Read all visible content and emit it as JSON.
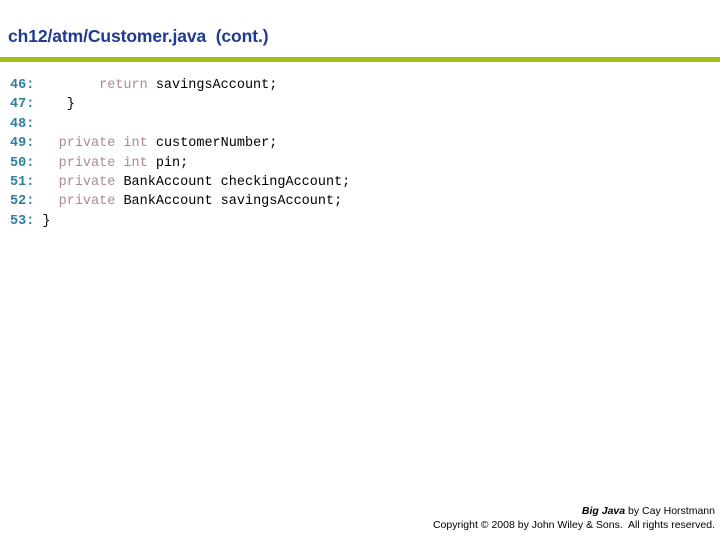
{
  "slide": {
    "title": "ch12/atm/Customer.java  (cont.)",
    "accent_green": "#a2c115",
    "title_color": "#1f3a93",
    "background": "#ffffff"
  },
  "code": {
    "language": "java",
    "line_number_color": "#2e7f9e",
    "keyword_color": "#ab8a96",
    "identifier_color": "#000000",
    "lines": [
      {
        "number": "46:",
        "segments": [
          {
            "text": "        ",
            "type": "plain"
          },
          {
            "text": "return",
            "type": "keyword"
          },
          {
            "text": " savingsAccount;",
            "type": "identifier"
          }
        ],
        "plain_text": "46:        return savingsAccount;"
      },
      {
        "number": "47:",
        "segments": [
          {
            "text": "    }",
            "type": "identifier"
          }
        ],
        "plain_text": "47:    }"
      },
      {
        "number": "48:",
        "segments": [],
        "plain_text": "48:"
      },
      {
        "number": "49:",
        "segments": [
          {
            "text": "   ",
            "type": "plain"
          },
          {
            "text": "private int",
            "type": "keyword"
          },
          {
            "text": " customerNumber;",
            "type": "identifier"
          }
        ],
        "plain_text": "49:   private int customerNumber;"
      },
      {
        "number": "50:",
        "segments": [
          {
            "text": "   ",
            "type": "plain"
          },
          {
            "text": "private int",
            "type": "keyword"
          },
          {
            "text": " pin;",
            "type": "identifier"
          }
        ],
        "plain_text": "50:   private int pin;"
      },
      {
        "number": "51:",
        "segments": [
          {
            "text": "   ",
            "type": "plain"
          },
          {
            "text": "private",
            "type": "keyword"
          },
          {
            "text": " BankAccount checkingAccount;",
            "type": "identifier"
          }
        ],
        "plain_text": "51:   private BankAccount checkingAccount;"
      },
      {
        "number": "52:",
        "segments": [
          {
            "text": "   ",
            "type": "plain"
          },
          {
            "text": "private",
            "type": "keyword"
          },
          {
            "text": " BankAccount savingsAccount;",
            "type": "identifier"
          }
        ],
        "plain_text": "52:   private BankAccount savingsAccount;"
      },
      {
        "number": "53:",
        "segments": [
          {
            "text": " }",
            "type": "identifier"
          }
        ],
        "plain_text": "53: }"
      }
    ]
  },
  "footer": {
    "book_title": "Big Java",
    "byline": " by Cay Horstmann",
    "copyright": "Copyright © 2008 by John Wiley & Sons.  All rights reserved."
  }
}
